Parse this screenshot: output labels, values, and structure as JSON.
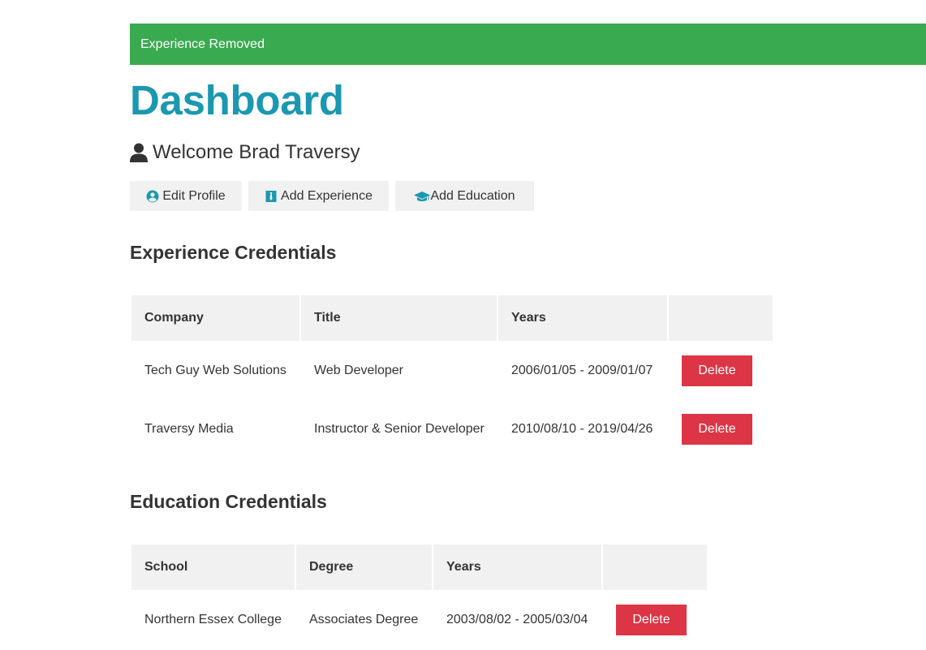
{
  "alert": {
    "message": "Experience Removed",
    "color": "#3aaa50"
  },
  "page": {
    "title": "Dashboard",
    "accent": "#1b98b0"
  },
  "welcome": {
    "icon": "user-icon",
    "text": "Welcome Brad Traversy"
  },
  "actions": [
    {
      "label": "Edit Profile",
      "icon": "user-circle-icon"
    },
    {
      "label": "Add Experience",
      "icon": "black-tie-icon"
    },
    {
      "label": "Add Education",
      "icon": "graduation-cap-icon"
    }
  ],
  "experience": {
    "title": "Experience Credentials",
    "headers": [
      "Company",
      "Title",
      "Years",
      ""
    ],
    "rows": [
      {
        "company": "Tech Guy Web Solutions",
        "title": "Web Developer",
        "years": "2006/01/05 - 2009/01/07",
        "action": "Delete"
      },
      {
        "company": "Traversy Media",
        "title": "Instructor & Senior Developer",
        "years": "2010/08/10 - 2019/04/26",
        "action": "Delete"
      }
    ]
  },
  "education": {
    "title": "Education Credentials",
    "headers": [
      "School",
      "Degree",
      "Years",
      ""
    ],
    "rows": [
      {
        "school": "Northern Essex College",
        "degree": "Associates Degree",
        "years": "2003/08/02 - 2005/03/04",
        "action": "Delete"
      }
    ]
  },
  "colors": {
    "danger": "#dc3545",
    "light": "#f1f1f1"
  }
}
